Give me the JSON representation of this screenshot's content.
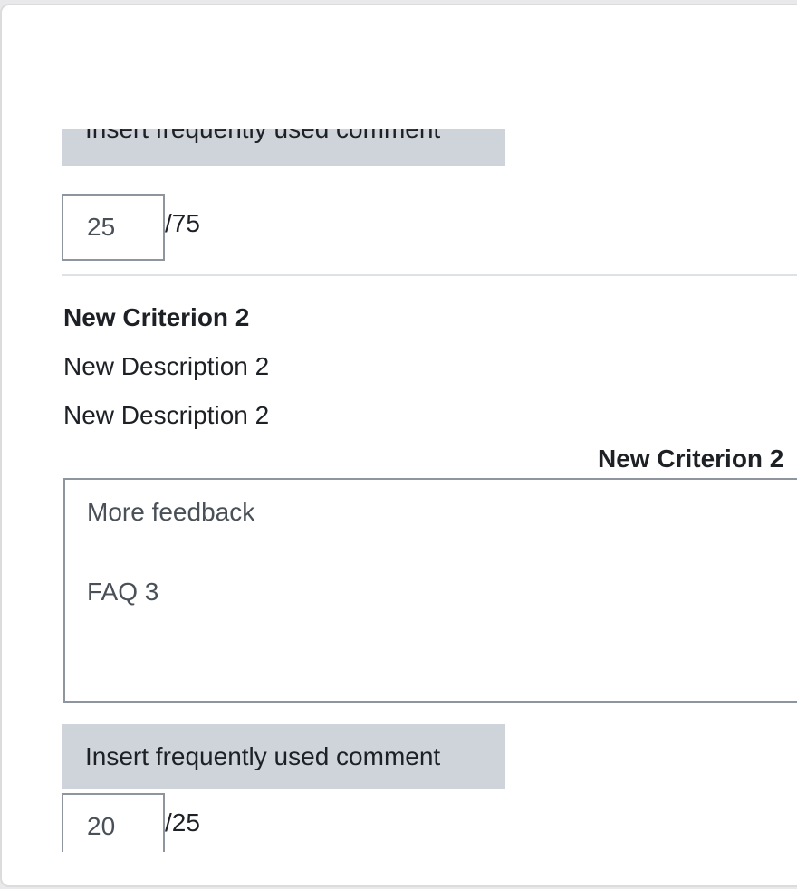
{
  "criteria": [
    {
      "comment_button_label": "Insert frequently used comment",
      "score_value": "25",
      "score_max": "/75"
    },
    {
      "title": "New Criterion 2",
      "descriptions": [
        "New Description 2",
        "New Description 2"
      ],
      "heading_right": "New Criterion 2",
      "feedback_lines": [
        "More feedback",
        "FAQ 3"
      ],
      "comment_button_label": "Insert frequently used comment",
      "score_value": "20",
      "score_max": "/25"
    }
  ]
}
